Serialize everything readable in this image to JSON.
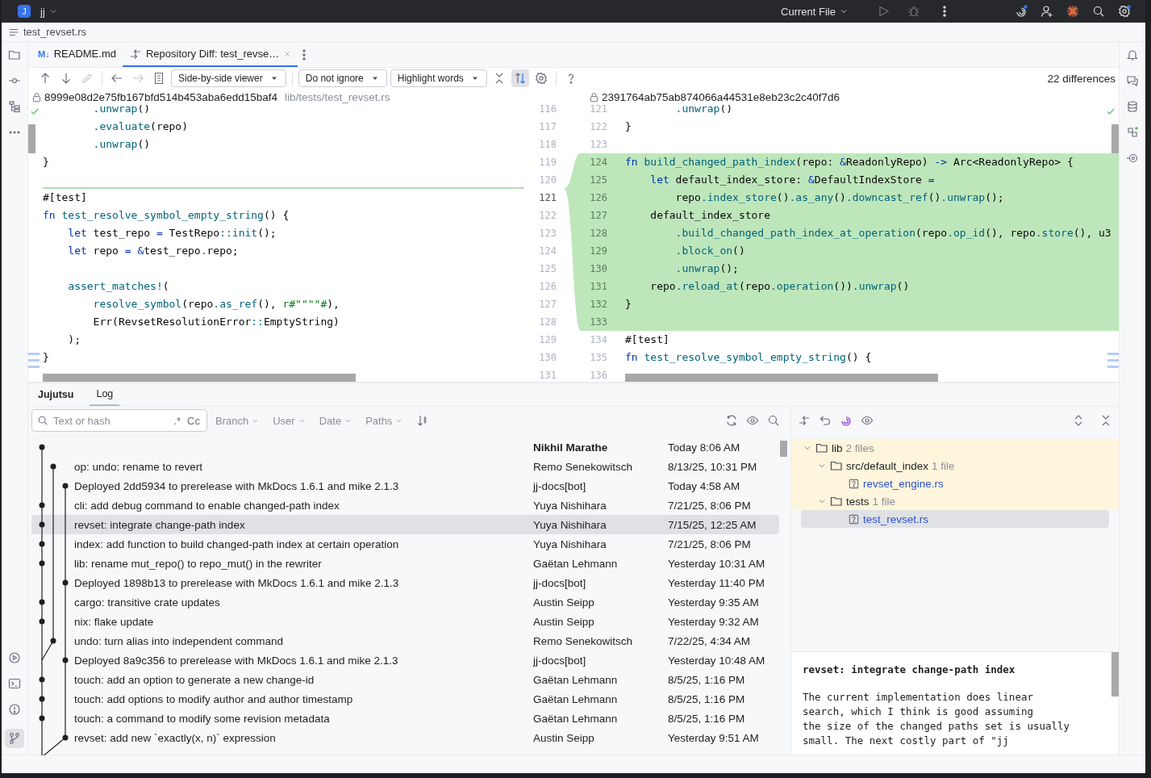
{
  "title_bar": {
    "project_badge": "J",
    "project": "jj",
    "run_config": "Current File"
  },
  "breadcrumb": {
    "file": "test_revset.rs"
  },
  "editor_tabs": [
    {
      "label": "README.md",
      "badge": "M↓",
      "kind": "markdown",
      "selected": false
    },
    {
      "label": "Repository Diff: test_revse…",
      "kind": "diff",
      "selected": true
    }
  ],
  "diff_toolbar": {
    "viewer": "Side-by-side viewer",
    "ignore": "Do not ignore",
    "highlight": "Highlight words",
    "sync_scroll": true,
    "differences": "22 differences"
  },
  "diff": {
    "left": {
      "revision": "8999e08d2e75fb167bfd514b453aba6edd15baf4",
      "path": "lib/tests/test_revset.rs",
      "lines": [
        {
          "num": "116",
          "current": false,
          "insert_below": false,
          "tokens": [
            {
              "kind": "method",
              "text": "        .unwrap"
            },
            {
              "kind": "plain",
              "text": "()"
            }
          ]
        },
        {
          "num": "117",
          "current": false,
          "insert_below": false,
          "tokens": [
            {
              "kind": "method",
              "text": "        .evaluate"
            },
            {
              "kind": "plain",
              "text": "(repo)"
            }
          ]
        },
        {
          "num": "118",
          "current": false,
          "insert_below": false,
          "tokens": [
            {
              "kind": "method",
              "text": "        .unwrap"
            },
            {
              "kind": "plain",
              "text": "()"
            }
          ]
        },
        {
          "num": "119",
          "current": false,
          "insert_below": false,
          "tokens": [
            {
              "kind": "plain",
              "text": "}"
            }
          ]
        },
        {
          "num": "120",
          "current": false,
          "insert_below": true
        },
        {
          "num": "121",
          "current": true,
          "insert_below": false,
          "tokens": [
            {
              "kind": "plain",
              "text": "#[test]"
            }
          ]
        },
        {
          "num": "122",
          "current": false,
          "insert_below": false,
          "tokens": [
            {
              "kind": "keyword",
              "text": "fn "
            },
            {
              "kind": "method",
              "text": "test_resolve_symbol_empty_string"
            },
            {
              "kind": "plain",
              "text": "() {"
            }
          ]
        },
        {
          "num": "123",
          "current": false,
          "insert_below": false,
          "tokens": [
            {
              "kind": "keyword",
              "text": "    let"
            },
            {
              "kind": "plain",
              "text": " test_repo "
            },
            {
              "kind": "keyword",
              "text": "="
            },
            {
              "kind": "plain",
              "text": " TestRepo"
            },
            {
              "kind": "method",
              "text": "::init"
            },
            {
              "kind": "plain",
              "text": "();"
            }
          ]
        },
        {
          "num": "124",
          "current": false,
          "insert_below": false,
          "tokens": [
            {
              "kind": "keyword",
              "text": "    let"
            },
            {
              "kind": "plain",
              "text": " repo "
            },
            {
              "kind": "keyword",
              "text": "= &"
            },
            {
              "kind": "plain",
              "text": "test_repo"
            },
            {
              "kind": "method",
              "text": "."
            },
            {
              "kind": "plain",
              "text": "repo;"
            }
          ]
        },
        {
          "num": "125",
          "current": false,
          "insert_below": false
        },
        {
          "num": "126",
          "current": false,
          "insert_below": false,
          "tokens": [
            {
              "kind": "method",
              "text": "    assert_matches!"
            },
            {
              "kind": "plain",
              "text": "("
            }
          ]
        },
        {
          "num": "127",
          "current": false,
          "insert_below": false,
          "tokens": [
            {
              "kind": "method",
              "text": "        resolve_symbol"
            },
            {
              "kind": "plain",
              "text": "(repo"
            },
            {
              "kind": "method",
              "text": ".as_ref"
            },
            {
              "kind": "plain",
              "text": "(), "
            },
            {
              "kind": "string",
              "text": "r#\"\"\"\"#"
            },
            {
              "kind": "plain",
              "text": "),"
            }
          ]
        },
        {
          "num": "128",
          "current": false,
          "insert_below": false,
          "tokens": [
            {
              "kind": "plain",
              "text": "        Err(RevsetResolutionError"
            },
            {
              "kind": "method",
              "text": "::"
            },
            {
              "kind": "plain",
              "text": "EmptyString)"
            }
          ]
        },
        {
          "num": "129",
          "current": false,
          "insert_below": false,
          "tokens": [
            {
              "kind": "plain",
              "text": "    );"
            }
          ]
        },
        {
          "num": "130",
          "current": false,
          "insert_below": false,
          "tokens": [
            {
              "kind": "plain",
              "text": "}"
            }
          ]
        },
        {
          "num": "131",
          "current": false
        }
      ]
    },
    "right": {
      "revision": "2391764ab75ab874066a44531e8eb23c2c40f7d6",
      "lines": [
        {
          "num": "121",
          "added": false,
          "tokens": [
            {
              "kind": "method",
              "text": "        .unwrap"
            },
            {
              "kind": "plain",
              "text": "()"
            }
          ]
        },
        {
          "num": "122",
          "added": false,
          "tokens": [
            {
              "kind": "plain",
              "text": "}"
            }
          ]
        },
        {
          "num": "123",
          "added": false
        },
        {
          "num": "124",
          "added": true,
          "tokens": [
            {
              "kind": "keyword",
              "text": "fn "
            },
            {
              "kind": "method",
              "text": "build_changed_path_index"
            },
            {
              "kind": "plain",
              "text": "(repo: "
            },
            {
              "kind": "keyword",
              "text": "&"
            },
            {
              "kind": "plain",
              "text": "ReadonlyRepo) "
            },
            {
              "kind": "keyword",
              "text": "->"
            },
            {
              "kind": "plain",
              "text": " Arc<ReadonlyRepo> {"
            }
          ]
        },
        {
          "num": "125",
          "added": true,
          "tokens": [
            {
              "kind": "keyword",
              "text": "    let"
            },
            {
              "kind": "plain",
              "text": " default_index_store: "
            },
            {
              "kind": "keyword",
              "text": "&"
            },
            {
              "kind": "plain",
              "text": "DefaultIndexStore "
            },
            {
              "kind": "keyword",
              "text": "="
            }
          ]
        },
        {
          "num": "126",
          "added": true,
          "tokens": [
            {
              "kind": "plain",
              "text": "        repo"
            },
            {
              "kind": "method",
              "text": ".index_store"
            },
            {
              "kind": "plain",
              "text": "()"
            },
            {
              "kind": "method",
              "text": ".as_any"
            },
            {
              "kind": "plain",
              "text": "()"
            },
            {
              "kind": "method",
              "text": ".downcast_ref"
            },
            {
              "kind": "plain",
              "text": "()"
            },
            {
              "kind": "method",
              "text": ".unwrap"
            },
            {
              "kind": "plain",
              "text": "();"
            }
          ]
        },
        {
          "num": "127",
          "added": true,
          "tokens": [
            {
              "kind": "plain",
              "text": "    default_index_store"
            }
          ]
        },
        {
          "num": "128",
          "added": true,
          "tokens": [
            {
              "kind": "method",
              "text": "        .build_changed_path_index_at_operation"
            },
            {
              "kind": "plain",
              "text": "(repo"
            },
            {
              "kind": "method",
              "text": ".op_id"
            },
            {
              "kind": "plain",
              "text": "(), repo"
            },
            {
              "kind": "method",
              "text": ".store"
            },
            {
              "kind": "plain",
              "text": "(), u3"
            }
          ]
        },
        {
          "num": "129",
          "added": true,
          "tokens": [
            {
              "kind": "method",
              "text": "        .block_on"
            },
            {
              "kind": "plain",
              "text": "()"
            }
          ]
        },
        {
          "num": "130",
          "added": true,
          "tokens": [
            {
              "kind": "method",
              "text": "        .unwrap"
            },
            {
              "kind": "plain",
              "text": "();"
            }
          ]
        },
        {
          "num": "131",
          "added": true,
          "tokens": [
            {
              "kind": "plain",
              "text": "    repo"
            },
            {
              "kind": "method",
              "text": ".reload_at"
            },
            {
              "kind": "plain",
              "text": "(repo"
            },
            {
              "kind": "method",
              "text": ".operation"
            },
            {
              "kind": "plain",
              "text": "())"
            },
            {
              "kind": "method",
              "text": ".unwrap"
            },
            {
              "kind": "plain",
              "text": "()"
            }
          ]
        },
        {
          "num": "132",
          "added": true,
          "tokens": [
            {
              "kind": "plain",
              "text": "}"
            }
          ]
        },
        {
          "num": "133",
          "added": true
        },
        {
          "num": "134",
          "added": false,
          "tokens": [
            {
              "kind": "plain",
              "text": "#[test]"
            }
          ]
        },
        {
          "num": "135",
          "added": false,
          "tokens": [
            {
              "kind": "keyword",
              "text": "fn "
            },
            {
              "kind": "method",
              "text": "test_resolve_symbol_empty_string"
            },
            {
              "kind": "plain",
              "text": "() {"
            }
          ]
        },
        {
          "num": "136",
          "added": false
        }
      ]
    }
  },
  "tool_window": {
    "title": "Jujutsu",
    "tabs": [
      {
        "label": "Log",
        "selected": true
      }
    ]
  },
  "log_filters": {
    "search": {
      "placeholder": "Text or hash",
      "regex": ".*",
      "match_case": "Cc"
    },
    "dropdowns": [
      "Branch",
      "User",
      "Date",
      "Paths"
    ]
  },
  "log": {
    "rows": [
      {
        "kind": "first",
        "current": true,
        "selected": false,
        "author": "Nikhil Marathe",
        "date": "Today 8:06 AM"
      },
      {
        "kind": "second",
        "current": false,
        "selected": false,
        "message": "op: undo: rename to revert",
        "author": "Remo Senekowitsch",
        "date": "8/13/25, 10:31 PM"
      },
      {
        "kind": "third",
        "current": false,
        "selected": false,
        "message": "Deployed 2dd5934 to prerelease with MkDocs 1.6.1 and mike 2.1.3",
        "author": "jj-docs[bot]",
        "date": "Today 4:58 AM"
      },
      {
        "kind": "first",
        "current": false,
        "selected": false,
        "message": "cli: add debug command to enable changed-path index",
        "author": "Yuya Nishihara",
        "date": "7/21/25, 8:06 PM"
      },
      {
        "kind": "first",
        "current": false,
        "selected": true,
        "message": "revset: integrate change-path index",
        "author": "Yuya Nishihara",
        "date": "7/15/25, 12:25 AM"
      },
      {
        "kind": "first",
        "current": false,
        "selected": false,
        "message": "index: add function to build changed-path index at certain operation",
        "author": "Yuya Nishihara",
        "date": "7/21/25, 8:06 PM"
      },
      {
        "kind": "first",
        "current": false,
        "selected": false,
        "message": "lib: rename mut_repo() to repo_mut() in the rewriter",
        "author": "Gaëtan Lehmann",
        "date": "Yesterday 10:31 AM"
      },
      {
        "kind": "third",
        "current": false,
        "selected": false,
        "message": "Deployed 1898b13 to prerelease with MkDocs 1.6.1 and mike 2.1.3",
        "author": "jj-docs[bot]",
        "date": "Yesterday 11:40 PM"
      },
      {
        "kind": "first",
        "current": false,
        "selected": false,
        "message": "cargo: transitive crate updates",
        "author": "Austin Seipp",
        "date": "Yesterday 9:35 AM"
      },
      {
        "kind": "first",
        "current": false,
        "selected": false,
        "message": "nix: flake update",
        "author": "Austin Seipp",
        "date": "Yesterday 9:32 AM"
      },
      {
        "kind": "second",
        "current": false,
        "selected": false,
        "message": "undo: turn alias into independent command",
        "author": "Remo Senekowitsch",
        "date": "7/22/25, 4:34 AM"
      },
      {
        "kind": "third",
        "current": false,
        "selected": false,
        "message": "Deployed 8a9c356 to prerelease with MkDocs 1.6.1 and mike 2.1.3",
        "author": "jj-docs[bot]",
        "date": "Yesterday 10:48 AM"
      },
      {
        "kind": "first",
        "current": false,
        "selected": false,
        "message": "touch: add an option to generate a new change-id",
        "author": "Gaëtan Lehmann",
        "date": "8/5/25, 1:16 PM"
      },
      {
        "kind": "first",
        "current": false,
        "selected": false,
        "message": "touch: add options to modify author and author timestamp",
        "author": "Gaëtan Lehmann",
        "date": "8/5/25, 1:16 PM"
      },
      {
        "kind": "first",
        "current": false,
        "selected": false,
        "message": "touch: a command to modify some revision metadata",
        "author": "Gaëtan Lehmann",
        "date": "8/5/25, 1:16 PM"
      },
      {
        "kind": "third",
        "current": false,
        "selected": false,
        "message": "revset: add new `exactly(x, n)` expression",
        "author": "Austin Seipp",
        "date": "Yesterday 9:51 AM"
      }
    ]
  },
  "changes": {
    "tree": [
      {
        "kind": "folder",
        "name": "lib",
        "count": "2 files",
        "expanded": true,
        "selected": false,
        "children": [
          {
            "kind": "folder",
            "name": "src/default_index",
            "count": "1 file",
            "expanded": true,
            "selected": false,
            "children": [
              {
                "kind": "file",
                "name": "revset_engine.rs",
                "selected": false
              }
            ]
          },
          {
            "kind": "folder",
            "name": "tests",
            "count": "1 file",
            "expanded": true,
            "selected": false,
            "children": [
              {
                "kind": "file",
                "name": "test_revset.rs",
                "selected": true
              }
            ]
          }
        ]
      }
    ],
    "commit_message": {
      "title": "revset: integrate change-path index",
      "body": "The current implementation does linear\nsearch, which I think is good assuming\nthe size of the changed paths set is usually\nsmall. The next costly part of \"jj"
    }
  }
}
